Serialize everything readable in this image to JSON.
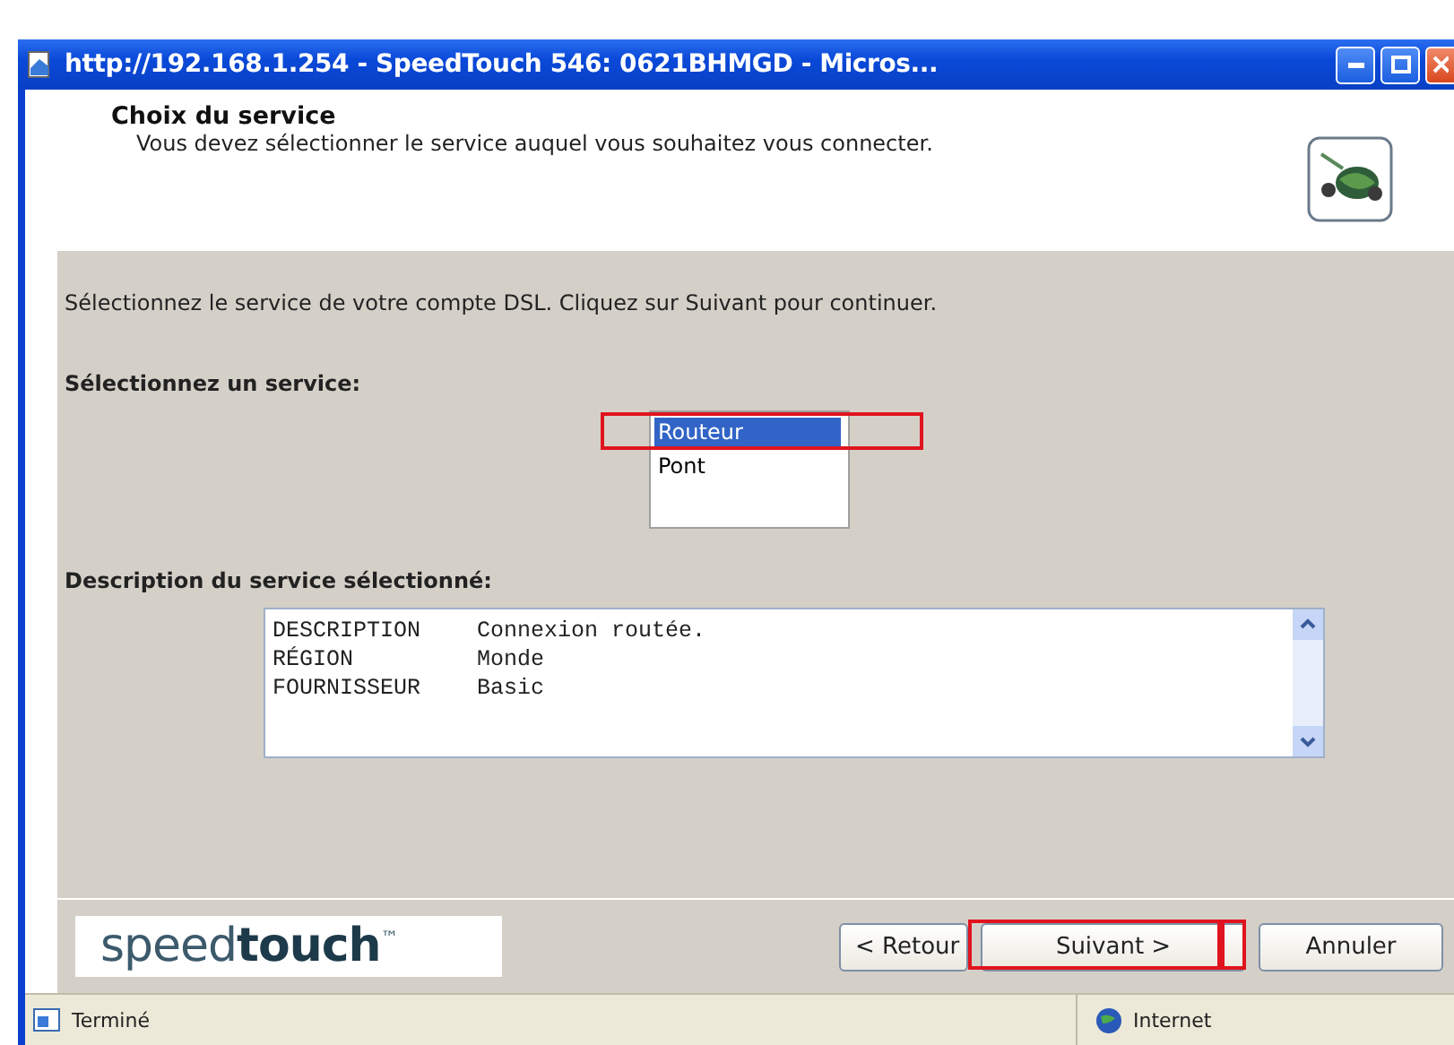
{
  "window": {
    "title": "http://192.168.1.254 - SpeedTouch 546: 0621BHMGD - Micros..."
  },
  "header": {
    "title": "Choix du service",
    "subtitle": "Vous devez sélectionner le service auquel vous souhaitez vous connecter."
  },
  "instruction": "Sélectionnez le service de votre compte DSL. Cliquez sur Suivant pour continuer.",
  "service_label": "Sélectionnez un service:",
  "services": [
    {
      "label": "Routeur",
      "selected": true
    },
    {
      "label": "Pont",
      "selected": false
    }
  ],
  "description_label": "Description du service sélectionné:",
  "description": [
    {
      "field": "DESCRIPTION",
      "value": "Connexion routée."
    },
    {
      "field": "RÉGION",
      "value": "Monde"
    },
    {
      "field": "FOURNISSEUR",
      "value": "Basic"
    }
  ],
  "logo": "speed**touch**$^{™}$",
  "buttons": [
    {
      "label": "< Retour"
    },
    {
      "label": "Suivant >"
    },
    {
      "label": "Annuler"
    }
  ],
  "status_bar": {
    "status": "Terminé",
    "zone": "Internet"
  }
}
